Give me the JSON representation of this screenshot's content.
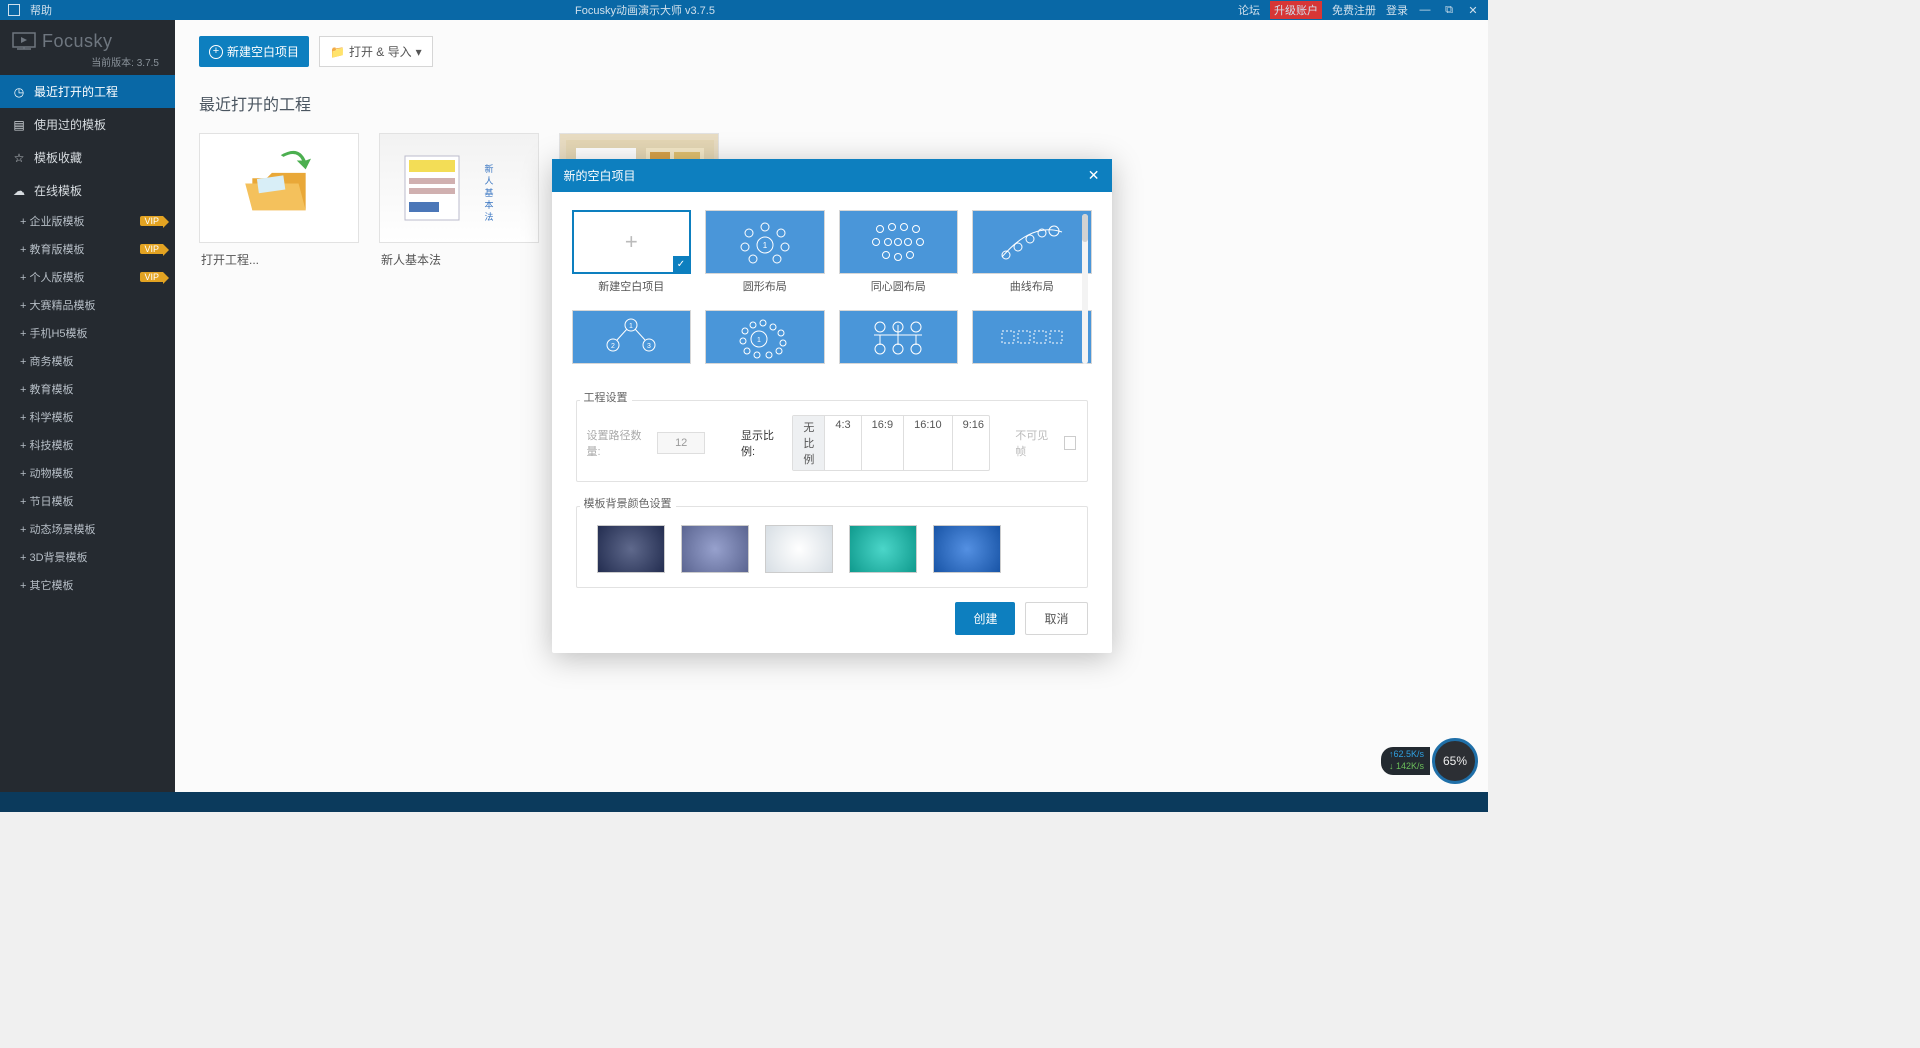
{
  "titlebar": {
    "help": "帮助",
    "app_title": "Focusky动画演示大师 v3.7.5",
    "forum": "论坛",
    "upgrade": "升级账户",
    "register": "免费注册",
    "login": "登录"
  },
  "brand": {
    "name": "Focusky",
    "version_label": "当前版本: 3.7.5"
  },
  "sidebar": {
    "recent": "最近打开的工程",
    "used_templates": "使用过的模板",
    "favorites": "模板收藏",
    "online": "在线模板",
    "subs": [
      {
        "label": "+ 企业版模板",
        "vip": "VIP"
      },
      {
        "label": "+ 教育版模板",
        "vip": "VIP"
      },
      {
        "label": "+ 个人版模板",
        "vip": "VIP"
      },
      {
        "label": "+ 大赛精品模板"
      },
      {
        "label": "+ 手机H5模板"
      },
      {
        "label": "+ 商务模板"
      },
      {
        "label": "+ 教育模板"
      },
      {
        "label": "+ 科学模板"
      },
      {
        "label": "+ 科技模板"
      },
      {
        "label": "+ 动物模板"
      },
      {
        "label": "+ 节日模板"
      },
      {
        "label": "+ 动态场景模板"
      },
      {
        "label": "+ 3D背景模板"
      },
      {
        "label": "+ 其它模板"
      }
    ]
  },
  "toolbar": {
    "new_blank": "新建空白项目",
    "open_import": "打开 & 导入"
  },
  "content": {
    "recent_title": "最近打开的工程",
    "proj1": "打开工程...",
    "proj2": "新人基本法"
  },
  "modal": {
    "title": "新的空白项目",
    "layouts": {
      "blank": "新建空白项目",
      "circle": "圆形布局",
      "concentric": "同心圆布局",
      "curve": "曲线布局"
    },
    "settings": {
      "group_title": "工程设置",
      "path_count_label": "设置路径数量:",
      "path_count_value": "12",
      "ratio_label": "显示比例:",
      "ratios": [
        "无比例",
        "4:3",
        "16:9",
        "16:10",
        "9:16"
      ],
      "invisible_frame": "不可见帧"
    },
    "bg": {
      "group_title": "模板背景颜色设置",
      "colors": [
        "#232d50",
        "#5b6591",
        "#d7dee4",
        "#0f9a8d",
        "#1854a6"
      ]
    },
    "create": "创建",
    "cancel": "取消"
  },
  "network": {
    "up": "↑62.5K/s",
    "down": "↓ 142K/s",
    "percent": "65%"
  }
}
